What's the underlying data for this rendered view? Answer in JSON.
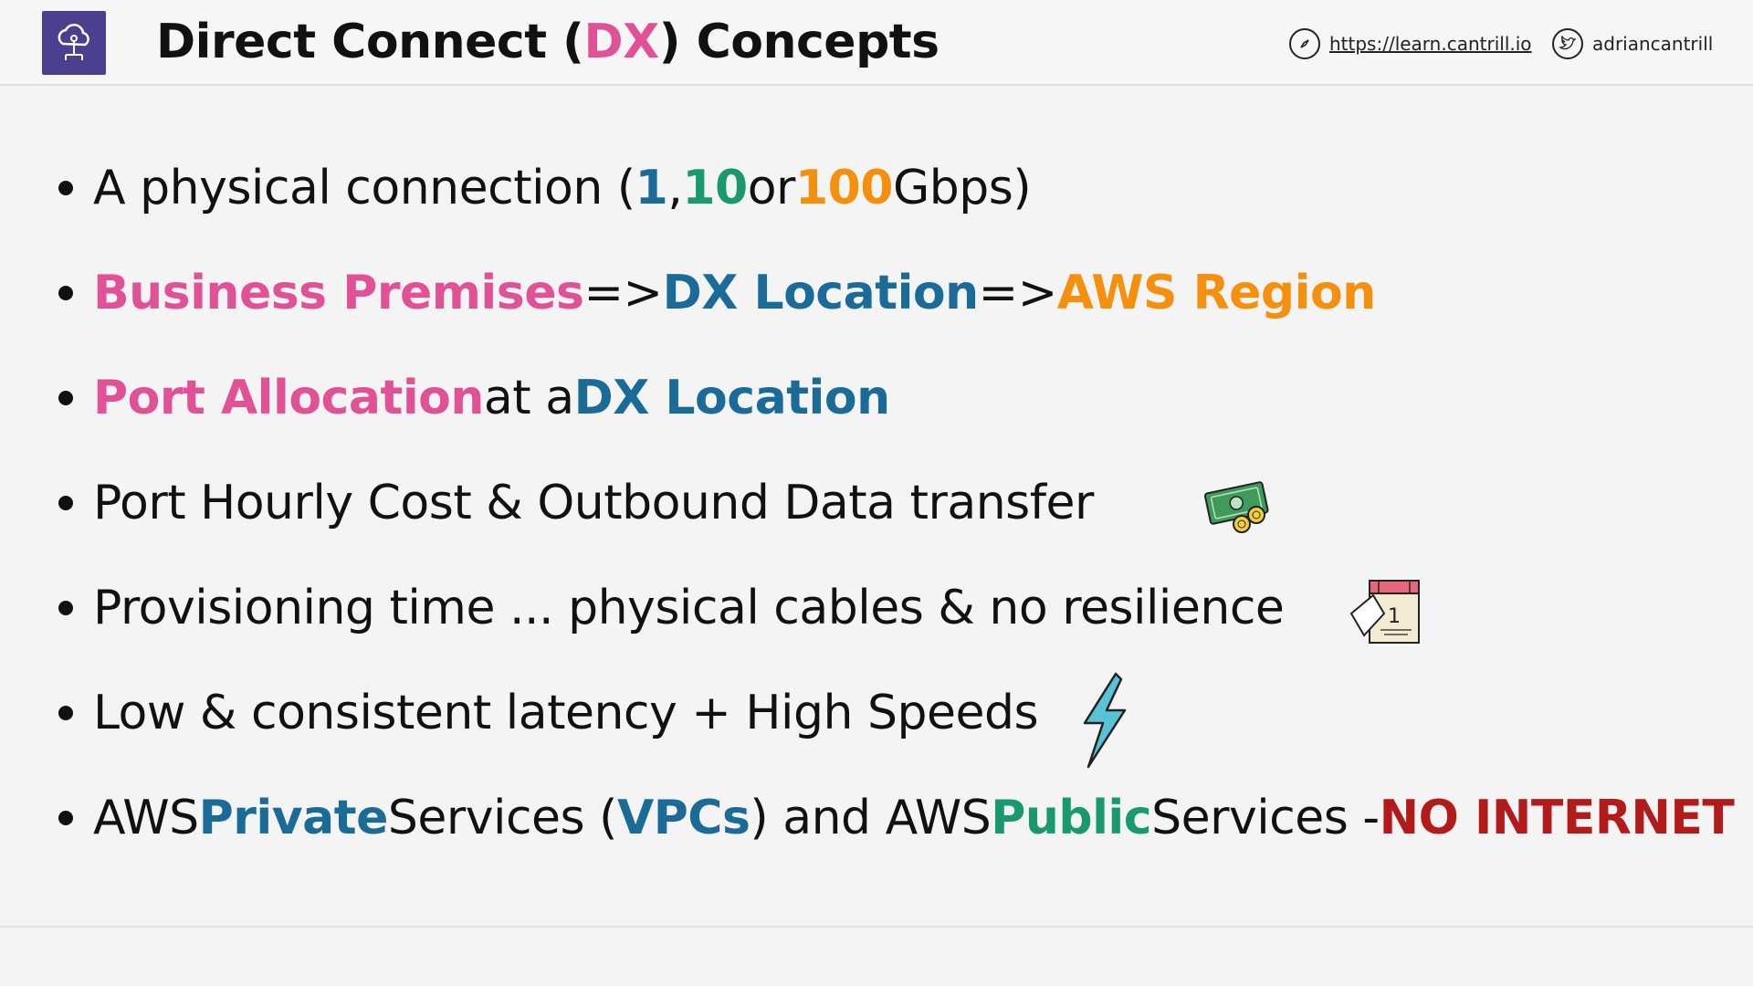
{
  "header": {
    "title_parts": [
      "Direct Connect (",
      "DX",
      ") Concepts"
    ],
    "website": "https://learn.cantrill.io",
    "twitter": "adriancantrill",
    "icons": {
      "logo": "cloud-network-icon",
      "site": "compass-icon",
      "twitter": "twitter-bird-icon"
    }
  },
  "colors": {
    "pink": "#e05195",
    "blue": "#1b6b98",
    "green": "#1a9a6c",
    "orange": "#f5900f",
    "red": "#b31b1b",
    "logo_bg": "#4b3f8f"
  },
  "bullets": [
    {
      "parts": [
        "A physical connection (",
        "1",
        ", ",
        "10",
        " or ",
        "100",
        " Gbps)"
      ]
    },
    {
      "parts": [
        "Business Premises",
        " => ",
        "DX Location",
        " => ",
        "AWS Region"
      ]
    },
    {
      "parts": [
        "Port Allocation",
        " at a ",
        "DX Location"
      ]
    },
    {
      "parts": [
        "Port Hourly Cost & Outbound Data transfer"
      ],
      "icon": "money-icon"
    },
    {
      "parts": [
        "Provisioning time ... physical cables & no resilience"
      ],
      "icon": "calendar-icon"
    },
    {
      "parts": [
        "Low & consistent latency + High Speeds"
      ],
      "icon": "lightning-icon"
    },
    {
      "parts": [
        "AWS ",
        "Private",
        " Services (",
        "VPCs",
        ") and AWS ",
        "Public",
        " Services - ",
        "NO INTERNET"
      ]
    }
  ]
}
